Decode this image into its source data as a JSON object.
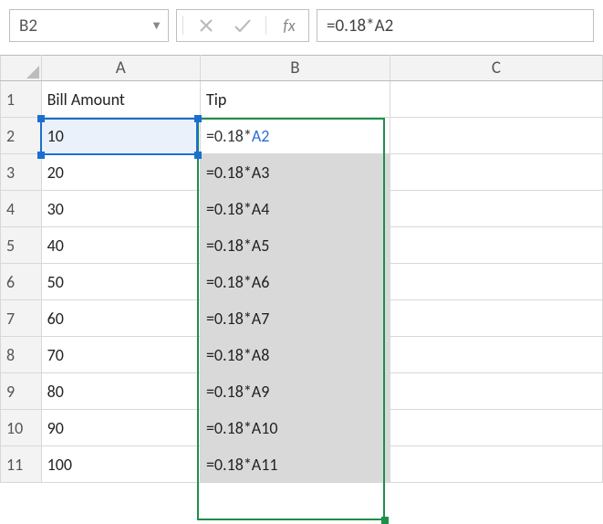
{
  "namebox": {
    "value": "B2"
  },
  "formula_bar": {
    "cancel_title": "Cancel",
    "enter_title": "Enter",
    "fx_label": "fx",
    "value": "=0.18*A2"
  },
  "columns": {
    "A": "A",
    "B": "B",
    "C": "C"
  },
  "rows": [
    {
      "n": "1",
      "A": "Bill Amount",
      "B": "Tip",
      "C": ""
    },
    {
      "n": "2",
      "A": "10",
      "B_prefix": "=0.18*",
      "B_ref": "A2",
      "C": ""
    },
    {
      "n": "3",
      "A": "20",
      "B": "=0.18*A3",
      "C": ""
    },
    {
      "n": "4",
      "A": "30",
      "B": "=0.18*A4",
      "C": ""
    },
    {
      "n": "5",
      "A": "40",
      "B": "=0.18*A5",
      "C": ""
    },
    {
      "n": "6",
      "A": "50",
      "B": "=0.18*A6",
      "C": ""
    },
    {
      "n": "7",
      "A": "60",
      "B": "=0.18*A7",
      "C": ""
    },
    {
      "n": "8",
      "A": "70",
      "B": "=0.18*A8",
      "C": ""
    },
    {
      "n": "9",
      "A": "80",
      "B": "=0.18*A9",
      "C": ""
    },
    {
      "n": "10",
      "A": "90",
      "B": "=0.18*A10",
      "C": ""
    },
    {
      "n": "11",
      "A": "100",
      "B": "=0.18*A11",
      "C": ""
    }
  ]
}
